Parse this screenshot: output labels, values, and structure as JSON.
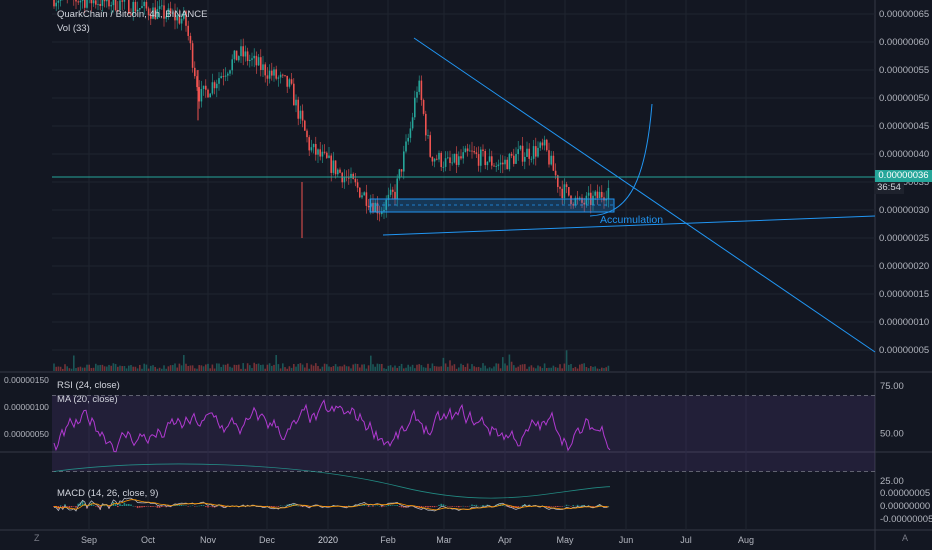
{
  "chart": {
    "symbol_title": "QuarkChain / Bitcoin, 4h, BINANCE",
    "volume_label": "Vol (33)",
    "last_price": "0.00000036",
    "countdown": "36:54",
    "annotation": "Accumulation",
    "x_labels": [
      "Sep",
      "Oct",
      "Nov",
      "Dec",
      "2020",
      "Feb",
      "Mar",
      "Apr",
      "May",
      "Jun",
      "Jul",
      "Aug"
    ],
    "price_ticks": [
      "0.00000065",
      "0.00000060",
      "0.00000055",
      "0.00000050",
      "0.00000045",
      "0.00000040",
      "0.00000035",
      "0.00000030",
      "0.00000025",
      "0.00000020",
      "0.00000015",
      "0.00000010",
      "0.00000005"
    ]
  },
  "rsi_pane": {
    "rsi_label": "RSI (24, close)",
    "ma_label": "MA (20, close)",
    "right_ticks": [
      "75.00",
      "50.00",
      "25.00"
    ],
    "left_ticks": [
      "0.00000150",
      "0.00000100",
      "0.00000050"
    ]
  },
  "macd_pane": {
    "label": "MACD (14, 26, close, 9)",
    "right_ticks": [
      "0.00000005",
      "0.00000000",
      "-0.00000005"
    ]
  },
  "footer": {
    "left_icon": "Z",
    "right_icon": "A"
  },
  "colors": {
    "up": "#26a69a",
    "down": "#ef5350",
    "drawing": "#2196f3",
    "rsi": "#b03ad0",
    "price_line": "#26a69a"
  }
}
